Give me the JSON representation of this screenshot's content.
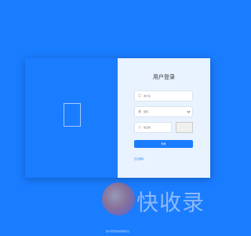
{
  "login": {
    "title": "用户登录",
    "username_placeholder": "用户名",
    "password_placeholder": "密码",
    "captcha_placeholder": "验证码",
    "submit_label": "登录",
    "forgot_label": "忘记密码"
  },
  "watermark": {
    "text": "快收录"
  },
  "footer": {
    "text": "用户登录系统管理平台"
  },
  "colors": {
    "primary": "#1a7cff",
    "panel": "#e9f2ff"
  }
}
